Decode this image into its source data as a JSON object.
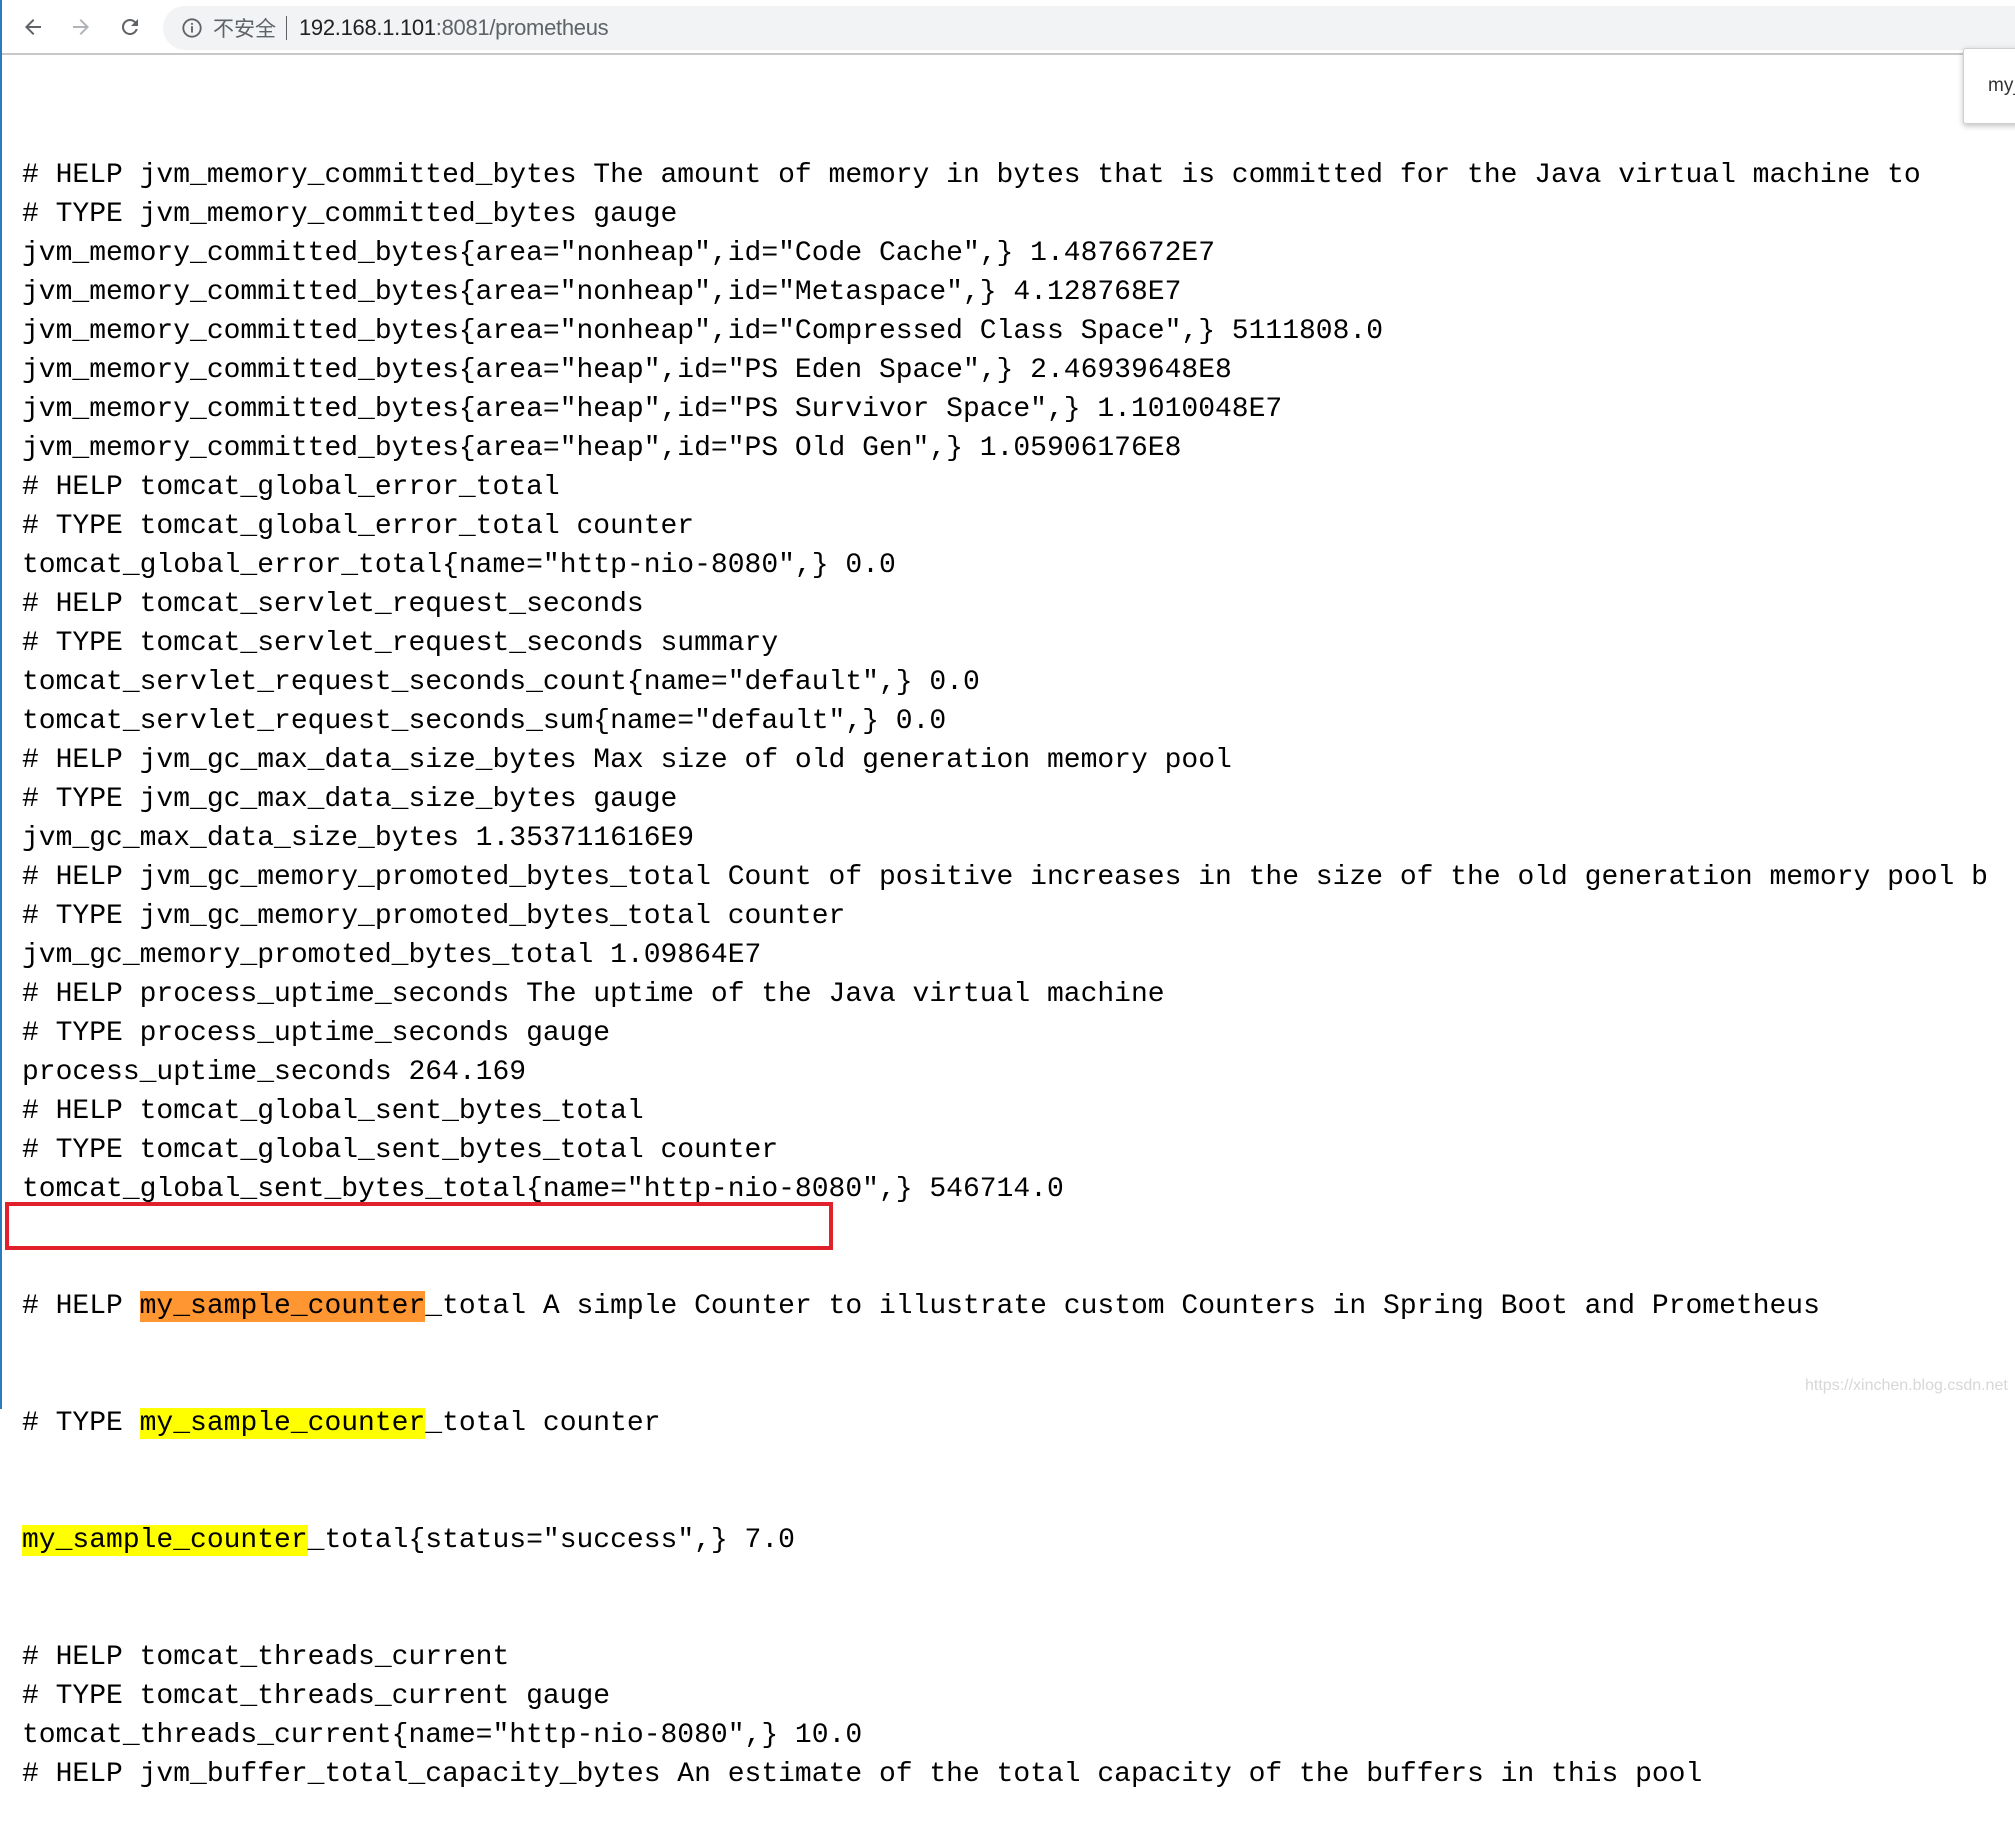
{
  "browser": {
    "security_label": "不安全",
    "url_host": "192.168.1.101",
    "url_rest": ":8081/prometheus",
    "find_popup_text": "my_"
  },
  "lines": [
    "# HELP jvm_memory_committed_bytes The amount of memory in bytes that is committed for the Java virtual machine to",
    "# TYPE jvm_memory_committed_bytes gauge",
    "jvm_memory_committed_bytes{area=\"nonheap\",id=\"Code Cache\",} 1.4876672E7",
    "jvm_memory_committed_bytes{area=\"nonheap\",id=\"Metaspace\",} 4.128768E7",
    "jvm_memory_committed_bytes{area=\"nonheap\",id=\"Compressed Class Space\",} 5111808.0",
    "jvm_memory_committed_bytes{area=\"heap\",id=\"PS Eden Space\",} 2.46939648E8",
    "jvm_memory_committed_bytes{area=\"heap\",id=\"PS Survivor Space\",} 1.1010048E7",
    "jvm_memory_committed_bytes{area=\"heap\",id=\"PS Old Gen\",} 1.05906176E8",
    "# HELP tomcat_global_error_total",
    "# TYPE tomcat_global_error_total counter",
    "tomcat_global_error_total{name=\"http-nio-8080\",} 0.0",
    "# HELP tomcat_servlet_request_seconds",
    "# TYPE tomcat_servlet_request_seconds summary",
    "tomcat_servlet_request_seconds_count{name=\"default\",} 0.0",
    "tomcat_servlet_request_seconds_sum{name=\"default\",} 0.0",
    "# HELP jvm_gc_max_data_size_bytes Max size of old generation memory pool",
    "# TYPE jvm_gc_max_data_size_bytes gauge",
    "jvm_gc_max_data_size_bytes 1.353711616E9",
    "# HELP jvm_gc_memory_promoted_bytes_total Count of positive increases in the size of the old generation memory pool b",
    "# TYPE jvm_gc_memory_promoted_bytes_total counter",
    "jvm_gc_memory_promoted_bytes_total 1.09864E7",
    "# HELP process_uptime_seconds The uptime of the Java virtual machine",
    "# TYPE process_uptime_seconds gauge",
    "process_uptime_seconds 264.169",
    "# HELP tomcat_global_sent_bytes_total",
    "# TYPE tomcat_global_sent_bytes_total counter",
    "tomcat_global_sent_bytes_total{name=\"http-nio-8080\",} 546714.0"
  ],
  "highlight": {
    "match": "my_sample_counter",
    "help_prefix": "# HELP ",
    "help_suffix": "_total A simple Counter to illustrate custom Counters in Spring Boot and Prometheus",
    "type_prefix": "# TYPE ",
    "type_suffix": "_total counter",
    "value_suffix": "_total{status=\"success\",} 7.0"
  },
  "lines_after": [
    "# HELP tomcat_threads_current",
    "# TYPE tomcat_threads_current gauge",
    "tomcat_threads_current{name=\"http-nio-8080\",} 10.0",
    "# HELP jvm_buffer_total_capacity_bytes An estimate of the total capacity of the buffers in this pool"
  ],
  "colors": {
    "current_match": "#ff9632",
    "other_match": "#ffff00",
    "annotation_box": "#e0202a"
  },
  "watermark": "https://xinchen.blog.csdn.net"
}
